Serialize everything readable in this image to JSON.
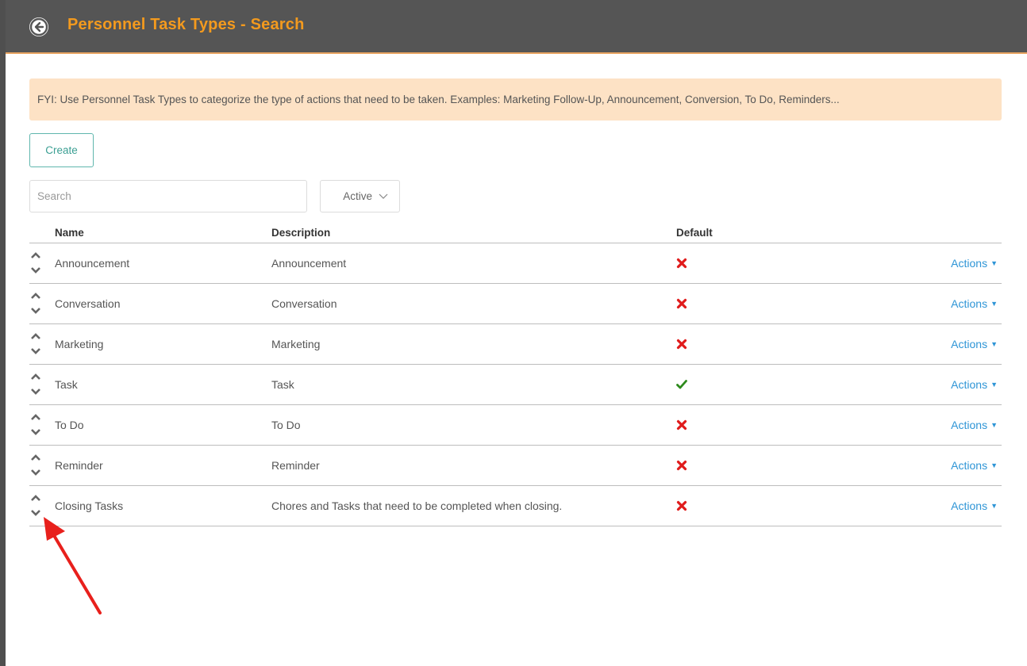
{
  "header": {
    "title": "Personnel Task Types - Search",
    "back_icon": "circle-arrow-left-icon"
  },
  "info": {
    "text": "FYI: Use Personnel Task Types to categorize the type of actions that need to be taken. Examples: Marketing Follow-Up, Announcement, Conversion, To Do, Reminders..."
  },
  "toolbar": {
    "create_label": "Create"
  },
  "filters": {
    "search_placeholder": "Search",
    "status_value": "Active"
  },
  "table": {
    "columns": {
      "name": "Name",
      "description": "Description",
      "default": "Default"
    },
    "rows": [
      {
        "name": "Announcement",
        "description": "Announcement",
        "default": false,
        "actions": "Actions"
      },
      {
        "name": "Conversation",
        "description": "Conversation",
        "default": false,
        "actions": "Actions"
      },
      {
        "name": "Marketing",
        "description": "Marketing",
        "default": false,
        "actions": "Actions"
      },
      {
        "name": "Task",
        "description": "Task",
        "default": true,
        "actions": "Actions"
      },
      {
        "name": "To Do",
        "description": "To Do",
        "default": false,
        "actions": "Actions"
      },
      {
        "name": "Reminder",
        "description": "Reminder",
        "default": false,
        "actions": "Actions"
      },
      {
        "name": "Closing Tasks",
        "description": "Chores and Tasks that need to be completed when closing.",
        "default": false,
        "actions": "Actions"
      }
    ]
  },
  "colors": {
    "header_bg": "#555555",
    "title": "#f39a1e",
    "banner_bg": "#fde2c5",
    "accent": "#3b9f93",
    "link": "#2e95d6",
    "false_mark": "#e01b1b",
    "true_mark": "#2d8a1c",
    "annotation_arrow": "#e8201c"
  }
}
